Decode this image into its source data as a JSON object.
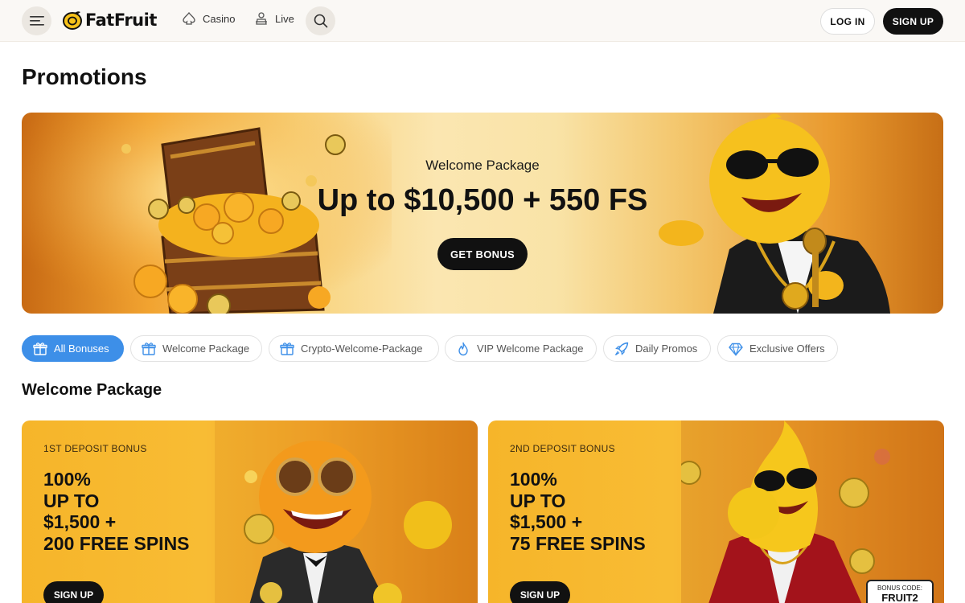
{
  "header": {
    "logo_text": "FatFruit",
    "nav": [
      {
        "label": "Casino",
        "icon": "spade-icon"
      },
      {
        "label": "Live",
        "icon": "dealer-icon"
      }
    ],
    "login_label": "LOG IN",
    "signup_label": "SIGN UP"
  },
  "page": {
    "title": "Promotions"
  },
  "hero": {
    "subtitle": "Welcome Package",
    "title": "Up to $10,500 + 550 FS",
    "cta": "GET BONUS"
  },
  "filters": [
    {
      "label": "All Bonuses",
      "icon": "gift-icon",
      "active": true
    },
    {
      "label": "Welcome Package",
      "icon": "gift-icon",
      "active": false
    },
    {
      "label": "Crypto-Welcome-Package",
      "icon": "gift-icon",
      "active": false
    },
    {
      "label": "VIP Welcome Package",
      "icon": "flame-icon",
      "active": false
    },
    {
      "label": "Daily Promos",
      "icon": "rocket-icon",
      "active": false
    },
    {
      "label": "Exclusive Offers",
      "icon": "diamond-icon",
      "active": false
    }
  ],
  "section": {
    "title": "Welcome Package"
  },
  "cards": [
    {
      "label": "1ST DEPOSIT BONUS",
      "lines": [
        "100%",
        "UP TO",
        "$1,500 +",
        "200 FREE SPINS"
      ],
      "cta": "SIGN UP"
    },
    {
      "label": "2ND DEPOSIT BONUS",
      "lines": [
        "100%",
        "UP TO",
        "$1,500 +",
        "75 FREE SPINS"
      ],
      "cta": "SIGN UP",
      "bonus_code_label": "BONUS CODE:",
      "bonus_code": "FRUIT2"
    }
  ],
  "colors": {
    "accent": "#3d8fe8",
    "dark": "#111111",
    "gold": "#f6b52a"
  }
}
